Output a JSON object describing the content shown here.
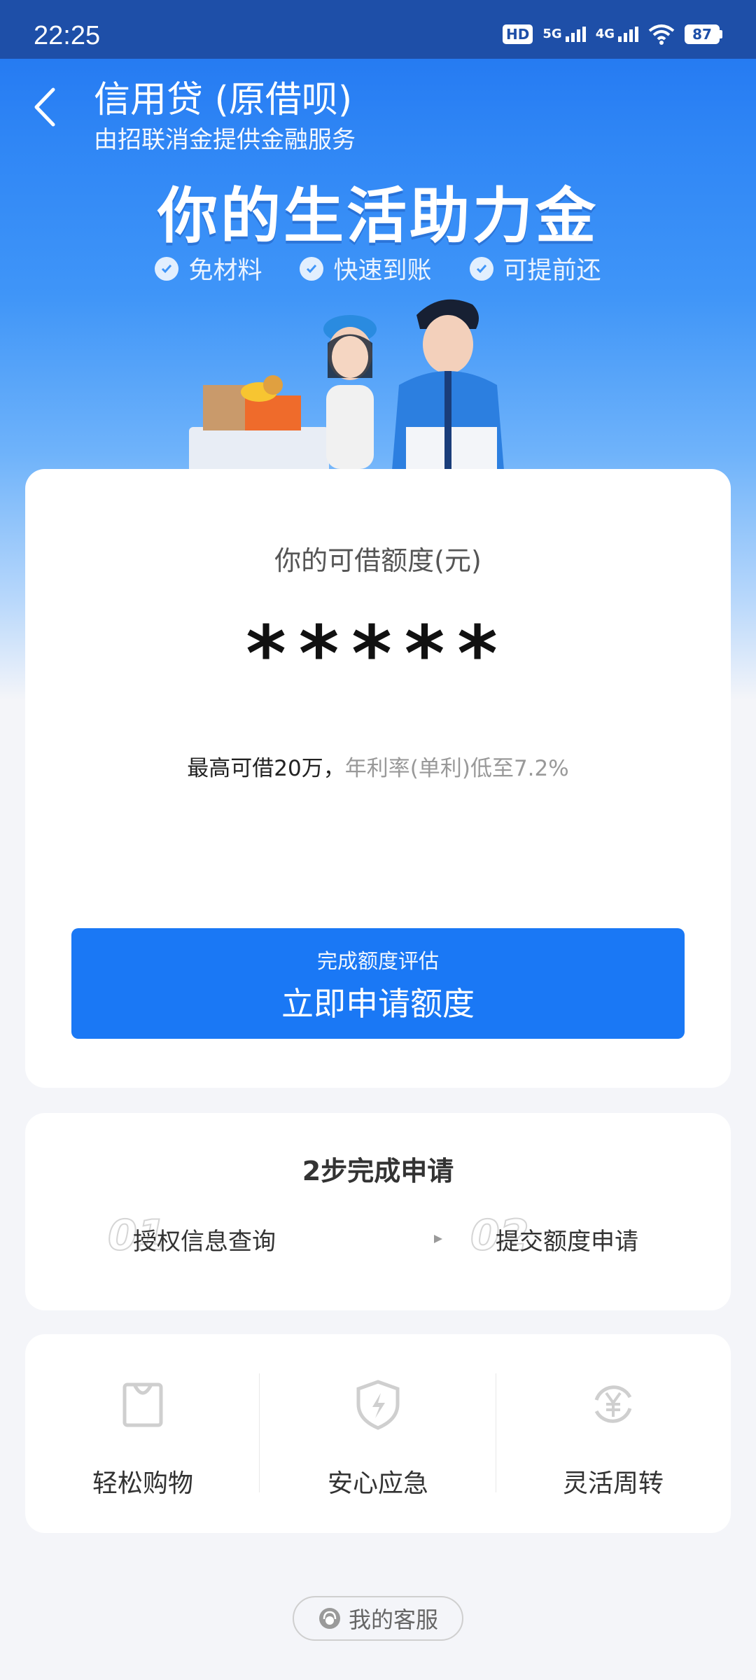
{
  "status_bar": {
    "time": "22:25",
    "hd_label": "HD",
    "net1_label": "5G",
    "net2_label": "4G",
    "battery": "87"
  },
  "header": {
    "title": "信用贷 (原借呗)",
    "subtitle": "由招联消金提供金融服务"
  },
  "hero": {
    "slogan": "你的生活助力金",
    "features": [
      "免材料",
      "快速到账",
      "可提前还"
    ]
  },
  "quota": {
    "label": "你的可借额度(元)",
    "value": "*****",
    "note_dark": "最高可借20万，",
    "note_grey": "年利率(单利)低至7.2%",
    "button_small": "完成额度评估",
    "button_big": "立即申请额度"
  },
  "steps": {
    "title": "2步完成申请",
    "items": [
      {
        "num": "01",
        "label": "授权信息查询"
      },
      {
        "num": "02",
        "label": "提交额度申请"
      }
    ]
  },
  "benefits": [
    {
      "icon": "shopping-bag-icon",
      "label": "轻松购物"
    },
    {
      "icon": "shield-lightning-icon",
      "label": "安心应急"
    },
    {
      "icon": "yuan-cycle-icon",
      "label": "灵活周转"
    }
  ],
  "service": {
    "label": "我的客服",
    "icon": "customer-service-icon"
  },
  "colors": {
    "primary": "#1a78f5",
    "status_bar": "#1e4fa8",
    "page_bg": "#f4f5f9"
  }
}
